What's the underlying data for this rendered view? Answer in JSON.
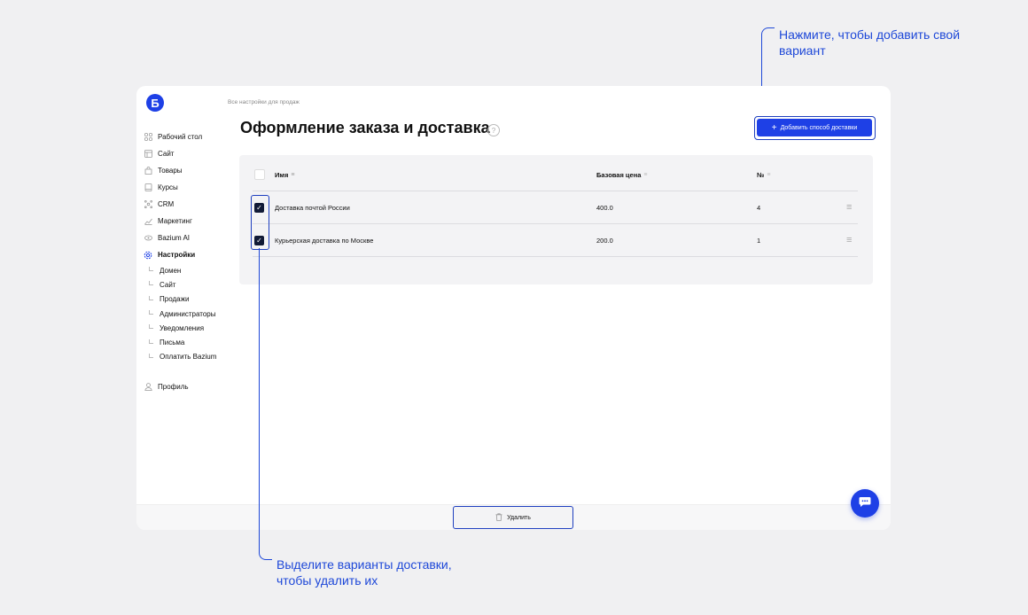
{
  "annotations": {
    "top_line1": "Нажмите, чтобы добавить свой",
    "top_line2": "вариант",
    "bottom_line1": "Выделите варианты доставки,",
    "bottom_line2": "чтобы удалить их"
  },
  "logo": {
    "letter": "Б"
  },
  "sidebar": {
    "items": [
      {
        "label": "Рабочий стол",
        "icon": "grid-icon"
      },
      {
        "label": "Сайт",
        "icon": "layout-icon"
      },
      {
        "label": "Товары",
        "icon": "bag-icon"
      },
      {
        "label": "Курсы",
        "icon": "book-icon"
      },
      {
        "label": "CRM",
        "icon": "network-icon"
      },
      {
        "label": "Маркетинг",
        "icon": "chart-icon"
      },
      {
        "label": "Bazium AI",
        "icon": "ai-icon"
      },
      {
        "label": "Настройки",
        "icon": "gear-icon"
      }
    ],
    "sub_items": [
      "Домен",
      "Сайт",
      "Продажи",
      "Администраторы",
      "Уведомления",
      "Письма",
      "Оплатить Bazium"
    ],
    "profile_label": "Профиль"
  },
  "header": {
    "breadcrumb": "Все настройки для продаж",
    "title": "Оформление заказа и доставка",
    "help_glyph": "?",
    "add_button_label": "Добавить способ доставки",
    "add_glyph": "+"
  },
  "table": {
    "columns": [
      "Имя",
      "Базовая цена",
      "№"
    ],
    "rows": [
      {
        "name": "Доставка почтой России",
        "price": "400.0",
        "number": "4",
        "checked": true
      },
      {
        "name": "Курьерская доставка по Москве",
        "price": "200.0",
        "number": "1",
        "checked": true
      }
    ]
  },
  "footer": {
    "delete_label": "Удалить"
  },
  "colors": {
    "accent": "#1e40e6",
    "annotation": "#1e48d8",
    "checkbox": "#111a36"
  }
}
